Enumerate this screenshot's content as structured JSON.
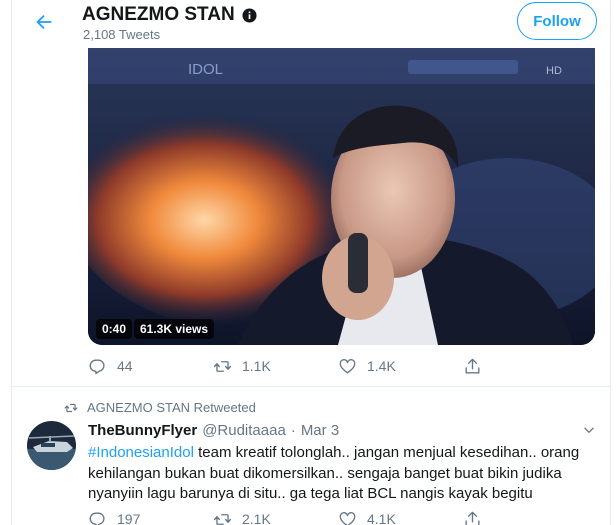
{
  "header": {
    "name": "AGNEZMO STAN",
    "tweet_count": "2,108 Tweets",
    "follow_label": "Follow"
  },
  "video": {
    "duration": "0:40",
    "views": "61.3K views"
  },
  "tweet1_actions": {
    "replies": "44",
    "retweets": "1.1K",
    "likes": "1.4K"
  },
  "retweet_notice": "AGNEZMO STAN Retweeted",
  "tweet2": {
    "name": "TheBunnyFlyer",
    "handle": "@Ruditaaaa",
    "separator": "·",
    "time": "Mar 3",
    "hashtag": "#IndonesianIdol",
    "text_line1": " team kreatif tolonglah.. jangan menjual kesedihan.. orang",
    "text_line2": "kehilangan bukan buat dikomersilkan.. sengaja banget buat bikin judika",
    "text_line3": "nyanyiin lagu barunya di situ.. ga tega liat BCL nangis kayak begitu",
    "actions": {
      "replies": "197",
      "retweets": "2.1K",
      "likes": "4.1K"
    }
  },
  "colors": {
    "accent": "#1da1f2",
    "secondary_text": "#657786",
    "primary_text": "#14171a",
    "border": "#e6ecf0"
  },
  "icons": [
    "back-arrow-icon",
    "verified-badge-icon",
    "reply-icon",
    "retweet-icon",
    "like-icon",
    "share-icon",
    "chevron-down-icon"
  ]
}
